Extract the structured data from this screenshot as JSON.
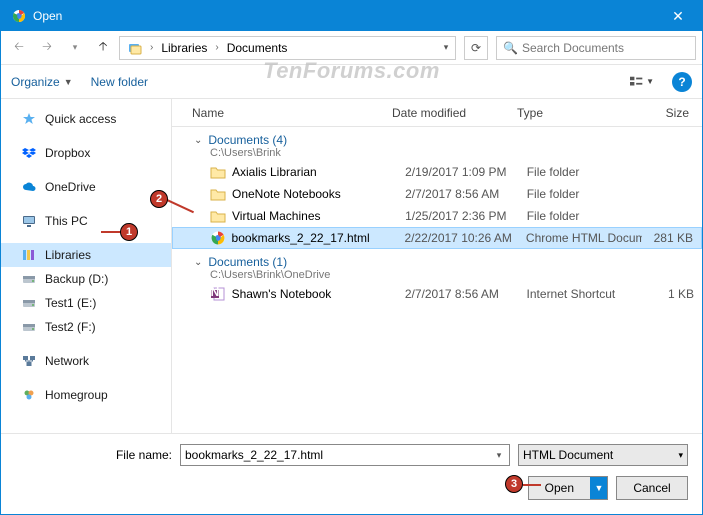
{
  "window": {
    "title": "Open"
  },
  "nav": {
    "search_placeholder": "Search Documents"
  },
  "breadcrumb": {
    "segments": [
      "Libraries",
      "Documents"
    ]
  },
  "toolbar": {
    "organize": "Organize",
    "newfolder": "New folder"
  },
  "columns": {
    "name": "Name",
    "date": "Date modified",
    "type": "Type",
    "size": "Size"
  },
  "navpane": {
    "items": [
      {
        "label": "Quick access",
        "icon": "star"
      },
      {
        "label": "Dropbox",
        "icon": "dropbox"
      },
      {
        "label": "OneDrive",
        "icon": "cloud"
      },
      {
        "label": "This PC",
        "icon": "pc"
      },
      {
        "label": "Libraries",
        "icon": "libraries",
        "selected": true
      },
      {
        "label": "Backup (D:)",
        "icon": "drive"
      },
      {
        "label": "Test1 (E:)",
        "icon": "drive"
      },
      {
        "label": "Test2 (F:)",
        "icon": "drive"
      },
      {
        "label": "Network",
        "icon": "network"
      },
      {
        "label": "Homegroup",
        "icon": "homegroup"
      }
    ]
  },
  "groups": [
    {
      "title": "Documents (4)",
      "subtitle": "C:\\Users\\Brink",
      "rows": [
        {
          "name": "Axialis Librarian",
          "date": "2/19/2017 1:09 PM",
          "type": "File folder",
          "size": "",
          "icon": "folder"
        },
        {
          "name": "OneNote Notebooks",
          "date": "2/7/2017 8:56 AM",
          "type": "File folder",
          "size": "",
          "icon": "folder"
        },
        {
          "name": "Virtual Machines",
          "date": "1/25/2017 2:36 PM",
          "type": "File folder",
          "size": "",
          "icon": "folder"
        },
        {
          "name": "bookmarks_2_22_17.html",
          "date": "2/22/2017 10:26 AM",
          "type": "Chrome HTML Document",
          "size": "281 KB",
          "icon": "chrome",
          "selected": true
        }
      ]
    },
    {
      "title": "Documents (1)",
      "subtitle": "C:\\Users\\Brink\\OneDrive",
      "rows": [
        {
          "name": "Shawn's Notebook",
          "date": "2/7/2017 8:56 AM",
          "type": "Internet Shortcut",
          "size": "1 KB",
          "icon": "onenote"
        }
      ]
    }
  ],
  "footer": {
    "label": "File name:",
    "value": "bookmarks_2_22_17.html",
    "filter": "HTML Document",
    "open": "Open",
    "cancel": "Cancel"
  },
  "badges": {
    "1": "1",
    "2": "2",
    "3": "3"
  },
  "watermark": "TenForums.com"
}
